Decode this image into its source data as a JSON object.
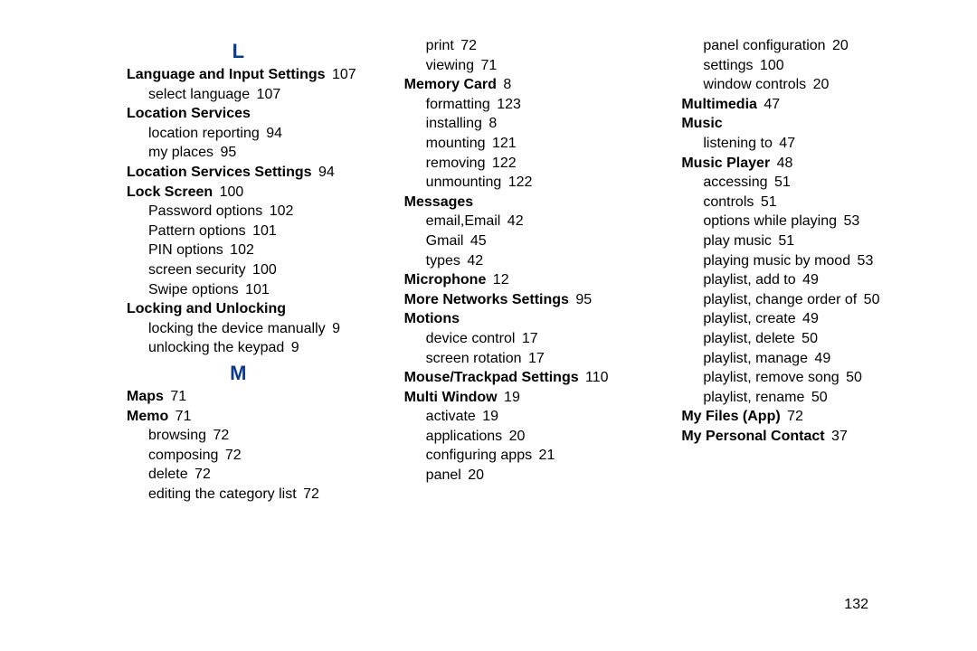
{
  "columns": [
    {
      "items": [
        {
          "type": "letter",
          "text": "L"
        },
        {
          "type": "entry",
          "level": 1,
          "bold": true,
          "text": "Language and Input Settings",
          "page": "107"
        },
        {
          "type": "entry",
          "level": 2,
          "bold": false,
          "text": "select language",
          "page": "107"
        },
        {
          "type": "entry",
          "level": 1,
          "bold": true,
          "text": "Location Services"
        },
        {
          "type": "entry",
          "level": 2,
          "bold": false,
          "text": "location reporting",
          "page": "94"
        },
        {
          "type": "entry",
          "level": 2,
          "bold": false,
          "text": "my places",
          "page": "95"
        },
        {
          "type": "entry",
          "level": 1,
          "bold": true,
          "text": "Location Services Settings",
          "page": "94"
        },
        {
          "type": "entry",
          "level": 1,
          "bold": true,
          "text": "Lock Screen",
          "page": "100"
        },
        {
          "type": "entry",
          "level": 2,
          "bold": false,
          "text": "Password options",
          "page": "102"
        },
        {
          "type": "entry",
          "level": 2,
          "bold": false,
          "text": "Pattern options",
          "page": "101"
        },
        {
          "type": "entry",
          "level": 2,
          "bold": false,
          "text": "PIN options",
          "page": "102"
        },
        {
          "type": "entry",
          "level": 2,
          "bold": false,
          "text": "screen security",
          "page": "100"
        },
        {
          "type": "entry",
          "level": 2,
          "bold": false,
          "text": "Swipe options",
          "page": "101"
        },
        {
          "type": "entry",
          "level": 1,
          "bold": true,
          "text": "Locking and Unlocking"
        },
        {
          "type": "entry",
          "level": 2,
          "bold": false,
          "text": "locking the device manually",
          "page": "9"
        },
        {
          "type": "entry",
          "level": 2,
          "bold": false,
          "text": "unlocking the keypad",
          "page": "9"
        },
        {
          "type": "letter",
          "text": "M"
        },
        {
          "type": "entry",
          "level": 1,
          "bold": true,
          "text": "Maps",
          "page": "71"
        },
        {
          "type": "entry",
          "level": 1,
          "bold": true,
          "text": "Memo",
          "page": "71"
        },
        {
          "type": "entry",
          "level": 2,
          "bold": false,
          "text": "browsing",
          "page": "72"
        },
        {
          "type": "entry",
          "level": 2,
          "bold": false,
          "text": "composing",
          "page": "72"
        },
        {
          "type": "entry",
          "level": 2,
          "bold": false,
          "text": "delete",
          "page": "72"
        },
        {
          "type": "entry",
          "level": 2,
          "bold": false,
          "text": "editing the category list",
          "page": "72"
        }
      ]
    },
    {
      "items": [
        {
          "type": "entry",
          "level": 2,
          "bold": false,
          "text": "print",
          "page": "72"
        },
        {
          "type": "entry",
          "level": 2,
          "bold": false,
          "text": "viewing",
          "page": "71"
        },
        {
          "type": "entry",
          "level": 1,
          "bold": true,
          "text": "Memory Card",
          "page": "8"
        },
        {
          "type": "entry",
          "level": 2,
          "bold": false,
          "text": "formatting",
          "page": "123"
        },
        {
          "type": "entry",
          "level": 2,
          "bold": false,
          "text": "installing",
          "page": "8"
        },
        {
          "type": "entry",
          "level": 2,
          "bold": false,
          "text": "mounting",
          "page": "121"
        },
        {
          "type": "entry",
          "level": 2,
          "bold": false,
          "text": "removing",
          "page": "122"
        },
        {
          "type": "entry",
          "level": 2,
          "bold": false,
          "text": "unmounting",
          "page": "122"
        },
        {
          "type": "entry",
          "level": 1,
          "bold": true,
          "text": "Messages"
        },
        {
          "type": "entry",
          "level": 2,
          "bold": false,
          "text": "email,Email",
          "page": "42"
        },
        {
          "type": "entry",
          "level": 2,
          "bold": false,
          "text": "Gmail",
          "page": "45"
        },
        {
          "type": "entry",
          "level": 2,
          "bold": false,
          "text": "types",
          "page": "42"
        },
        {
          "type": "entry",
          "level": 1,
          "bold": true,
          "text": "Microphone",
          "page": "12"
        },
        {
          "type": "entry",
          "level": 1,
          "bold": true,
          "text": "More Networks Settings",
          "page": "95"
        },
        {
          "type": "entry",
          "level": 1,
          "bold": true,
          "text": "Motions"
        },
        {
          "type": "entry",
          "level": 2,
          "bold": false,
          "text": "device control",
          "page": "17"
        },
        {
          "type": "entry",
          "level": 2,
          "bold": false,
          "text": "screen rotation",
          "page": "17"
        },
        {
          "type": "entry",
          "level": 1,
          "bold": true,
          "text": "Mouse/Trackpad Settings",
          "page": "110"
        },
        {
          "type": "entry",
          "level": 1,
          "bold": true,
          "text": "Multi Window",
          "page": "19"
        },
        {
          "type": "entry",
          "level": 2,
          "bold": false,
          "text": "activate",
          "page": "19"
        },
        {
          "type": "entry",
          "level": 2,
          "bold": false,
          "text": "applications",
          "page": "20"
        },
        {
          "type": "entry",
          "level": 2,
          "bold": false,
          "text": "configuring apps",
          "page": "21"
        },
        {
          "type": "entry",
          "level": 2,
          "bold": false,
          "text": "panel",
          "page": "20"
        }
      ]
    },
    {
      "items": [
        {
          "type": "entry",
          "level": 2,
          "bold": false,
          "text": "panel configuration",
          "page": "20"
        },
        {
          "type": "entry",
          "level": 2,
          "bold": false,
          "text": "settings",
          "page": "100"
        },
        {
          "type": "entry",
          "level": 2,
          "bold": false,
          "text": "window controls",
          "page": "20"
        },
        {
          "type": "entry",
          "level": 1,
          "bold": true,
          "text": "Multimedia",
          "page": "47"
        },
        {
          "type": "entry",
          "level": 1,
          "bold": true,
          "text": "Music"
        },
        {
          "type": "entry",
          "level": 2,
          "bold": false,
          "text": "listening to",
          "page": "47"
        },
        {
          "type": "entry",
          "level": 1,
          "bold": true,
          "text": "Music Player",
          "page": "48"
        },
        {
          "type": "entry",
          "level": 2,
          "bold": false,
          "text": "accessing",
          "page": "51"
        },
        {
          "type": "entry",
          "level": 2,
          "bold": false,
          "text": "controls",
          "page": "51"
        },
        {
          "type": "entry",
          "level": 2,
          "bold": false,
          "text": "options while playing",
          "page": "53"
        },
        {
          "type": "entry",
          "level": 2,
          "bold": false,
          "text": "play music",
          "page": "51"
        },
        {
          "type": "entry",
          "level": 2,
          "bold": false,
          "text": "playing music by mood",
          "page": "53"
        },
        {
          "type": "entry",
          "level": 2,
          "bold": false,
          "text": "playlist, add to",
          "page": "49"
        },
        {
          "type": "entry",
          "level": 2,
          "bold": false,
          "text": "playlist, change order of",
          "page": "50"
        },
        {
          "type": "entry",
          "level": 2,
          "bold": false,
          "text": "playlist, create",
          "page": "49"
        },
        {
          "type": "entry",
          "level": 2,
          "bold": false,
          "text": "playlist, delete",
          "page": "50"
        },
        {
          "type": "entry",
          "level": 2,
          "bold": false,
          "text": "playlist, manage",
          "page": "49"
        },
        {
          "type": "entry",
          "level": 2,
          "bold": false,
          "text": "playlist, remove song",
          "page": "50"
        },
        {
          "type": "entry",
          "level": 2,
          "bold": false,
          "text": "playlist, rename",
          "page": "50"
        },
        {
          "type": "entry",
          "level": 1,
          "bold": true,
          "text": "My Files (App)",
          "page": "72"
        },
        {
          "type": "entry",
          "level": 1,
          "bold": true,
          "text": "My Personal Contact",
          "page": "37"
        }
      ]
    }
  ],
  "pageNumber": "132"
}
